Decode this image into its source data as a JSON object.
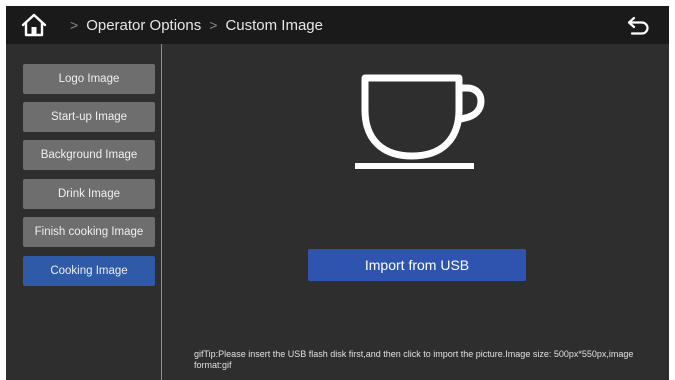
{
  "header": {
    "crumbs": [
      "Operator Options",
      "Custom Image"
    ],
    "separator": ">"
  },
  "sidebar": {
    "items": [
      {
        "label": "Logo Image"
      },
      {
        "label": "Start-up Image"
      },
      {
        "label": "Background Image"
      },
      {
        "label": "Drink Image"
      },
      {
        "label": "Finish cooking Image"
      },
      {
        "label": "Cooking Image",
        "selected": true
      }
    ]
  },
  "main": {
    "preview_icon": "coffee-cup-icon",
    "import_label": "Import from USB",
    "tip": "gifTip:Please insert the USB flash disk first,and then click to import the picture.Image size: 500px*550px,image format:gif"
  },
  "colors": {
    "topbar": "#1a1a1a",
    "background": "#2e2e2e",
    "button": "#6e6e6e",
    "active": "#2e5aa8",
    "import_button": "#2f54b0"
  },
  "icons": {
    "home": "home-icon",
    "back": "back-arrow-icon"
  }
}
